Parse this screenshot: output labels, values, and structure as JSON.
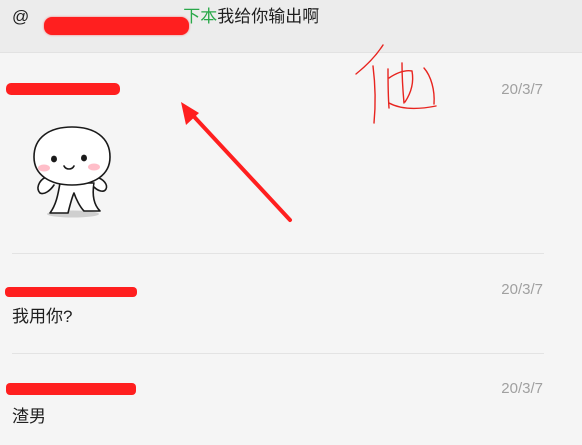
{
  "quote": {
    "at_symbol": "@",
    "highlight": "下本",
    "rest": "我给你输出啊"
  },
  "annotation": {
    "handwritten": "他"
  },
  "messages": [
    {
      "time": "20/3/7",
      "text": "",
      "sticker": "smiling-blob-sticker"
    },
    {
      "time": "20/3/7",
      "text": "我用你?"
    },
    {
      "time": "20/3/7",
      "text": "渣男"
    }
  ],
  "colors": {
    "redaction": "#ff1f1f",
    "highlight_green": "#2aa84a",
    "timestamp": "#a0a0a0",
    "background": "#f5f5f5",
    "quote_background": "#ececec"
  }
}
